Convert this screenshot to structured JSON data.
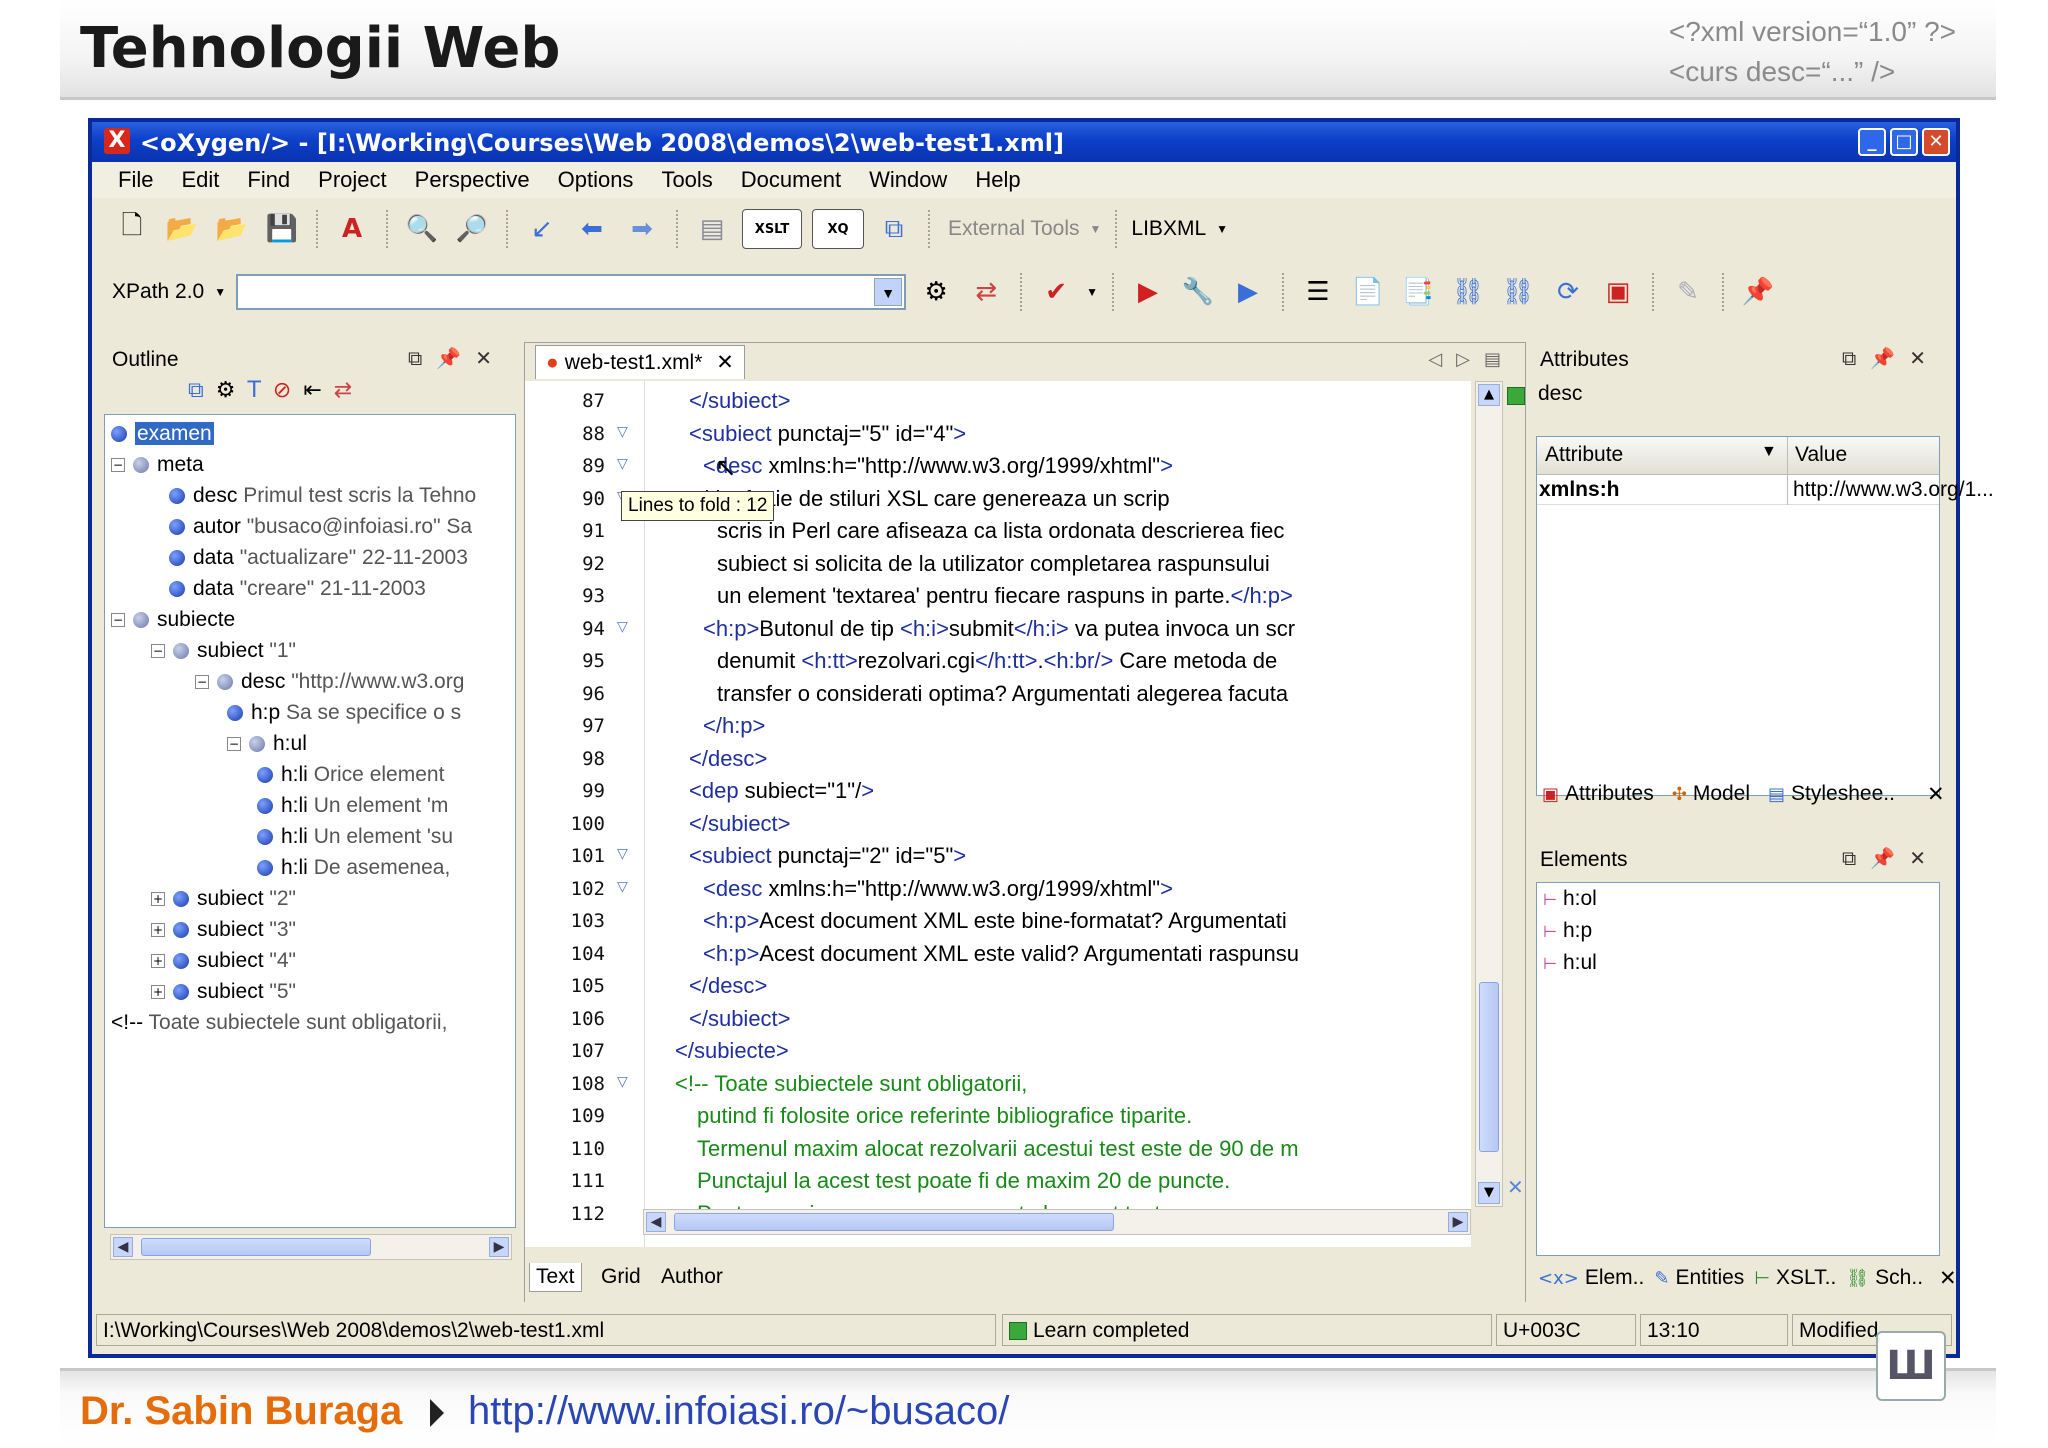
{
  "slide": {
    "title": "Tehnologii Web",
    "xml_line1": "<?xml version=“1.0” ?>",
    "xml_line2": "<curs desc=“...” />",
    "author": "Dr. Sabin Buraga",
    "url": "http://www.infoiasi.ro/~busaco/"
  },
  "window": {
    "title": "<oXygen/> - [I:\\Working\\Courses\\Web 2008\\demos\\2\\web-test1.xml]"
  },
  "menu": [
    "File",
    "Edit",
    "Find",
    "Project",
    "Perspective",
    "Options",
    "Tools",
    "Document",
    "Window",
    "Help"
  ],
  "toolbar": {
    "external_tools": "External Tools",
    "libxml": "LIBXML",
    "xpath_label": "XPath 2.0",
    "xpath_value": ""
  },
  "outline": {
    "title": "Outline",
    "nodes": [
      {
        "tag": "examen",
        "val": ""
      },
      {
        "tag": "meta",
        "val": ""
      },
      {
        "tag": "desc",
        "val": "Primul test scris la Tehno"
      },
      {
        "tag": "autor",
        "val": "\"busaco@infoiasi.ro\" Sa"
      },
      {
        "tag": "data",
        "val": "\"actualizare\" 22-11-2003"
      },
      {
        "tag": "data",
        "val": "\"creare\" 21-11-2003"
      },
      {
        "tag": "subiecte",
        "val": ""
      },
      {
        "tag": "subiect",
        "val": "\"1\""
      },
      {
        "tag": "desc",
        "val": "\"http://www.w3.org"
      },
      {
        "tag": "h:p",
        "val": "Sa se specifice o s"
      },
      {
        "tag": "h:ul",
        "val": ""
      },
      {
        "tag": "h:li",
        "val": "Orice element"
      },
      {
        "tag": "h:li",
        "val": "Un element 'm"
      },
      {
        "tag": "h:li",
        "val": "Un element 'su"
      },
      {
        "tag": "h:li",
        "val": "De asemenea,"
      },
      {
        "tag": "subiect",
        "val": "\"2\""
      },
      {
        "tag": "subiect",
        "val": "\"3\""
      },
      {
        "tag": "subiect",
        "val": "\"4\""
      },
      {
        "tag": "subiect",
        "val": "\"5\""
      },
      {
        "tag": "<!--",
        "val": "Toate subiectele sunt obligatorii,"
      }
    ]
  },
  "editor": {
    "tab": "web-test1.xml*",
    "tooltip": "Lines to fold : 12",
    "line_numbers": [
      "87",
      "88",
      "89",
      "90",
      "91",
      "92",
      "93",
      "94",
      "95",
      "96",
      "97",
      "98",
      "99",
      "100",
      "101",
      "102",
      "103",
      "104",
      "105",
      "106",
      "107",
      "108",
      "109",
      "110",
      "111",
      "112"
    ],
    "lines": [
      "</subiect>",
      "<subiect punctaj=\"5\" id=\"4\">",
      "<desc xmlns:h=\"http://www.w3.org/1999/xhtml\">",
      "ocmiti o foaie de stiluri XSL care genereaza un scrip",
      "scris in Perl care afiseaza ca lista ordonata descrierea fiec",
      "subiect si solicita de la utilizator completarea raspunsului",
      "un element 'textarea' pentru fiecare raspuns in parte.</h:p>",
      "<h:p>Butonul de tip <h:i>submit</h:i> va putea invoca un scr",
      "denumit <h:tt>rezolvari.cgi</h:tt>.<h:br/> Care metoda de",
      "transfer o considerati optima? Argumentati alegerea facuta",
      "</h:p>",
      "</desc>",
      "<dep subiect=\"1\"/>",
      "</subiect>",
      "<subiect punctaj=\"2\" id=\"5\">",
      "<desc xmlns:h=\"http://www.w3.org/1999/xhtml\">",
      "<h:p>Acest document XML este bine-formatat? Argumentati",
      "<h:p>Acest document XML este valid? Argumentati raspunsu",
      "</desc>",
      "</subiect>",
      "</subiecte>",
      "<!-- Toate subiectele sunt obligatorii,",
      "putind fi folosite orice referinte bibliografice tiparite.",
      "Termenul maxim alocat rezolvarii acestui test este de 90 de m",
      "Punctajul la acest test poate fi de maxim 20 de puncte.",
      "Pentru a asigura promovarea, nota la acest test"
    ],
    "modes": [
      "Text",
      "Grid",
      "Author"
    ]
  },
  "attributes": {
    "title": "Attributes",
    "element": "desc",
    "col_attr": "Attribute",
    "col_value": "Value",
    "row_attr": "xmlns:h",
    "row_value": "http://www.w3.org/1...",
    "tabs": [
      "Attributes",
      "Model",
      "Styleshee.."
    ]
  },
  "elements": {
    "title": "Elements",
    "items": [
      "h:ol",
      "h:p",
      "h:ul"
    ],
    "tabs": [
      "Elem..",
      "Entities",
      "XSLT..",
      "Sch.."
    ]
  },
  "status": {
    "path": "I:\\Working\\Courses\\Web 2008\\demos\\2\\web-test1.xml",
    "message": "Learn completed",
    "unicode": "U+003C",
    "position": "13:10",
    "state": "Modified"
  },
  "colors": {
    "title_bar": "#0d3fc8",
    "tag": "#1f2fa0",
    "attr": "#e07a14",
    "string": "#c0398c",
    "comment": "#188a18"
  }
}
